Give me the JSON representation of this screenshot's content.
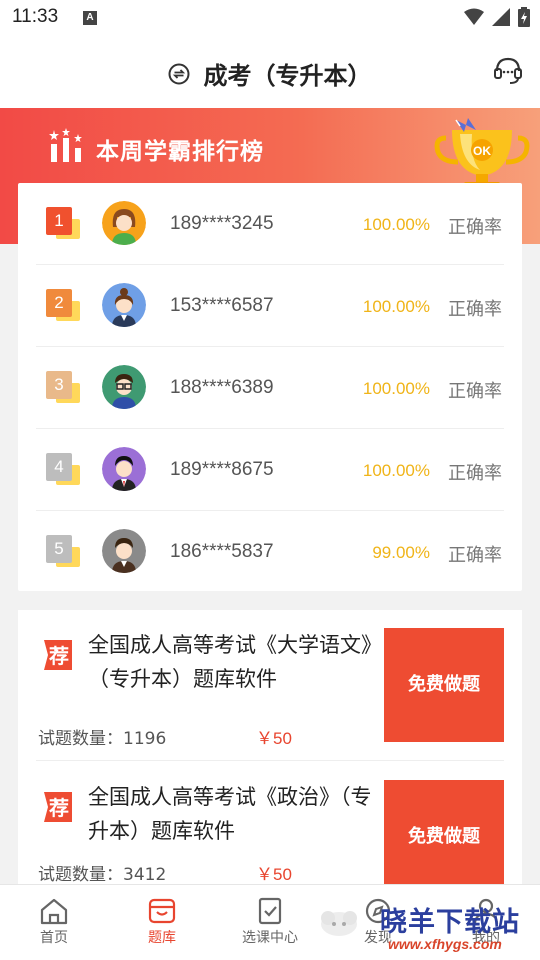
{
  "status_bar": {
    "time": "11:33",
    "notif_letter": "A"
  },
  "header": {
    "title": "成考（专升本）"
  },
  "banner": {
    "title": "本周学霸排行榜"
  },
  "colors": {
    "accent": "#ee4c32",
    "percent": "#f0b418",
    "banner_start": "#f24a46"
  },
  "ranking": [
    {
      "rank": "1",
      "phone": "189****3245",
      "percent": "100.00%",
      "label": "正确率",
      "avatar": "girl-avatar-icon",
      "badge_color": "#f0512e"
    },
    {
      "rank": "2",
      "phone": "153****6587",
      "percent": "100.00%",
      "label": "正确率",
      "avatar": "woman-avatar-icon",
      "badge_color": "#f08a3c"
    },
    {
      "rank": "3",
      "phone": "188****6389",
      "percent": "100.00%",
      "label": "正确率",
      "avatar": "boy-glasses-avatar-icon",
      "badge_color": "#e9b98a"
    },
    {
      "rank": "4",
      "phone": "189****8675",
      "percent": "100.00%",
      "label": "正确率",
      "avatar": "man-suit-avatar-icon",
      "badge_color": "#bdbdbd"
    },
    {
      "rank": "5",
      "phone": "186****5837",
      "percent": "99.00%",
      "label": "正确率",
      "avatar": "man-avatar-icon",
      "badge_color": "#bdbdbd"
    }
  ],
  "products": [
    {
      "badge": "荐",
      "title": "全国成人高等考试《大学语文》（专升本）题库软件",
      "count": "试题数量：1196",
      "price": "￥50",
      "button": "免费做题"
    },
    {
      "badge": "荐",
      "title": "全国成人高等考试《政治》（专升本）题库软件",
      "count": "试题数量：3412",
      "price": "￥50",
      "button": "免费做题"
    }
  ],
  "tabs": [
    {
      "label": "首页",
      "icon": "home-icon",
      "active": false
    },
    {
      "label": "题库",
      "icon": "question-bank-icon",
      "active": true
    },
    {
      "label": "选课中心",
      "icon": "course-center-icon",
      "active": false
    },
    {
      "label": "发现",
      "icon": "discover-icon",
      "active": false
    },
    {
      "label": "我的",
      "icon": "profile-icon",
      "active": false
    }
  ],
  "watermark": {
    "text": "晓羊下载站",
    "url": "www.xfhygs.com"
  }
}
